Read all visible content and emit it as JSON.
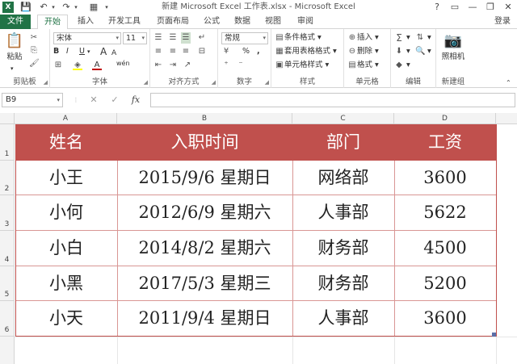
{
  "window": {
    "title": "新建 Microsoft Excel 工作表.xlsx - Microsoft Excel",
    "logo": "X",
    "controls": [
      "?",
      "▭",
      "—",
      "❐",
      "✕"
    ]
  },
  "tabs": {
    "file": "文件",
    "home": "开始",
    "items": [
      "插入",
      "开发工具",
      "页面布局",
      "公式",
      "数据",
      "视图",
      "审阅"
    ],
    "login": "登录"
  },
  "ribbon": {
    "clipboard": {
      "label": "剪贴板",
      "paste": "粘贴"
    },
    "font": {
      "label": "字体",
      "name": "宋体",
      "size": "11",
      "bold": "B",
      "italic": "I",
      "underline": "U",
      "wen": "wén",
      "grow": "A",
      "shrink": "A"
    },
    "alignment": {
      "label": "对齐方式"
    },
    "number": {
      "label": "数字",
      "format": "常规",
      "percent": "%",
      "comma": ","
    },
    "styles": {
      "label": "样式",
      "conditional": "条件格式",
      "table": "套用表格格式",
      "cell": "单元格样式"
    },
    "cells": {
      "label": "单元格",
      "insert": "插入",
      "delete": "删除",
      "format": "格式"
    },
    "editing": {
      "label": "编辑"
    },
    "newgroup": {
      "label": "新建组",
      "camera": "照相机"
    }
  },
  "formula_bar": {
    "name_box": "B9",
    "cancel": "✕",
    "enter": "✓",
    "fx": "fx",
    "value": ""
  },
  "sheet": {
    "columns": [
      "A",
      "B",
      "C",
      "D"
    ],
    "rows": [
      "1",
      "2",
      "3",
      "4",
      "5",
      "6"
    ],
    "header": [
      "姓名",
      "入职时间",
      "部门",
      "工资"
    ],
    "data": [
      [
        "小王",
        "2015/9/6  星期日",
        "网络部",
        "3600"
      ],
      [
        "小何",
        "2012/6/9  星期六",
        "人事部",
        "5622"
      ],
      [
        "小白",
        "2014/8/2  星期六",
        "财务部",
        "4500"
      ],
      [
        "小黑",
        "2017/5/3  星期三",
        "财务部",
        "5200"
      ],
      [
        "小天",
        "2011/9/4  星期日",
        "人事部",
        "3600"
      ]
    ]
  },
  "colors": {
    "accent": "#217346",
    "table_header": "#c0504d",
    "table_line": "#d99694"
  }
}
